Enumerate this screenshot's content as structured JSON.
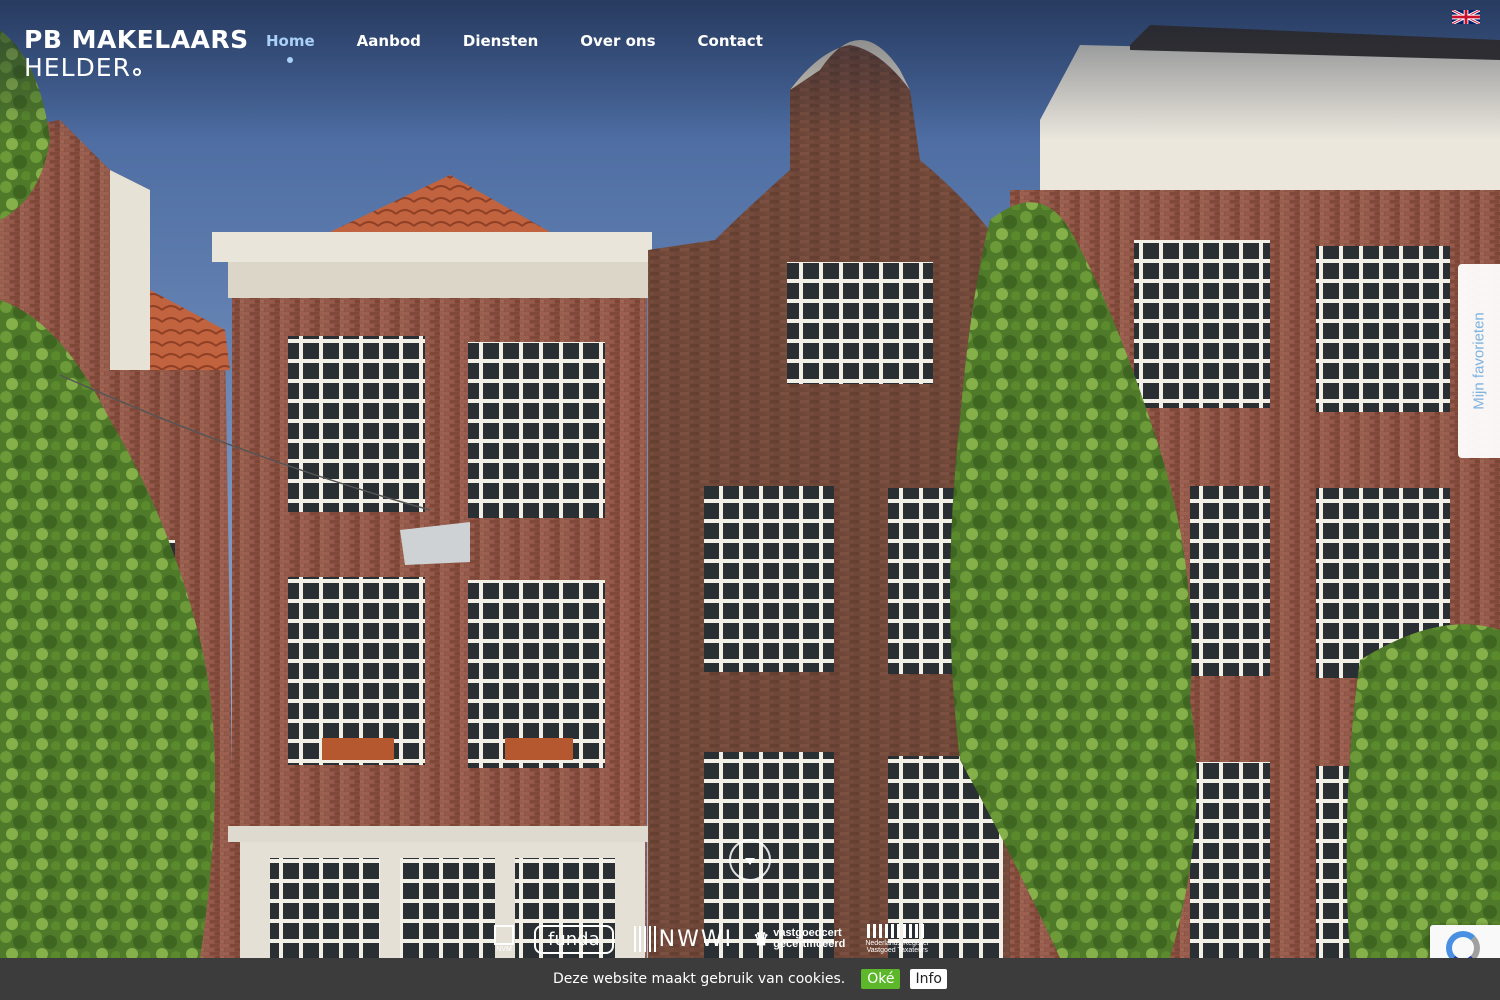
{
  "header": {
    "logo_line1": "PB MAKELAARS",
    "logo_line2": "HELDER"
  },
  "nav": {
    "items": [
      {
        "label": "Home",
        "active": true
      },
      {
        "label": "Aanbod",
        "active": false
      },
      {
        "label": "Diensten",
        "active": false
      },
      {
        "label": "Over ons",
        "active": false
      },
      {
        "label": "Contact",
        "active": false
      }
    ],
    "active_color": "#a9d0f5"
  },
  "language": {
    "icon": "uk-flag-icon"
  },
  "favorites_tab": {
    "label": "Mijn favorieten"
  },
  "scroll_button": {
    "icon": "chevron-down-icon"
  },
  "partners": {
    "nvm": "NVM",
    "funda": "funda",
    "nwwi": "NWWI",
    "vastgoedcert_line1": "vastgoedcert",
    "vastgoedcert_line2": "gecertificeerd",
    "vastgoedcert_icon": "crown-icon",
    "nrvt_line1": "Nederlands Register",
    "nrvt_line2": "Vastgoed Taxateurs"
  },
  "cookie_bar": {
    "message": "Deze website maakt gebruik van cookies.",
    "ok_label": "Oké",
    "info_label": "Info",
    "ok_color": "#5cb82a"
  },
  "recaptcha": {
    "icon": "recaptcha-icon"
  }
}
